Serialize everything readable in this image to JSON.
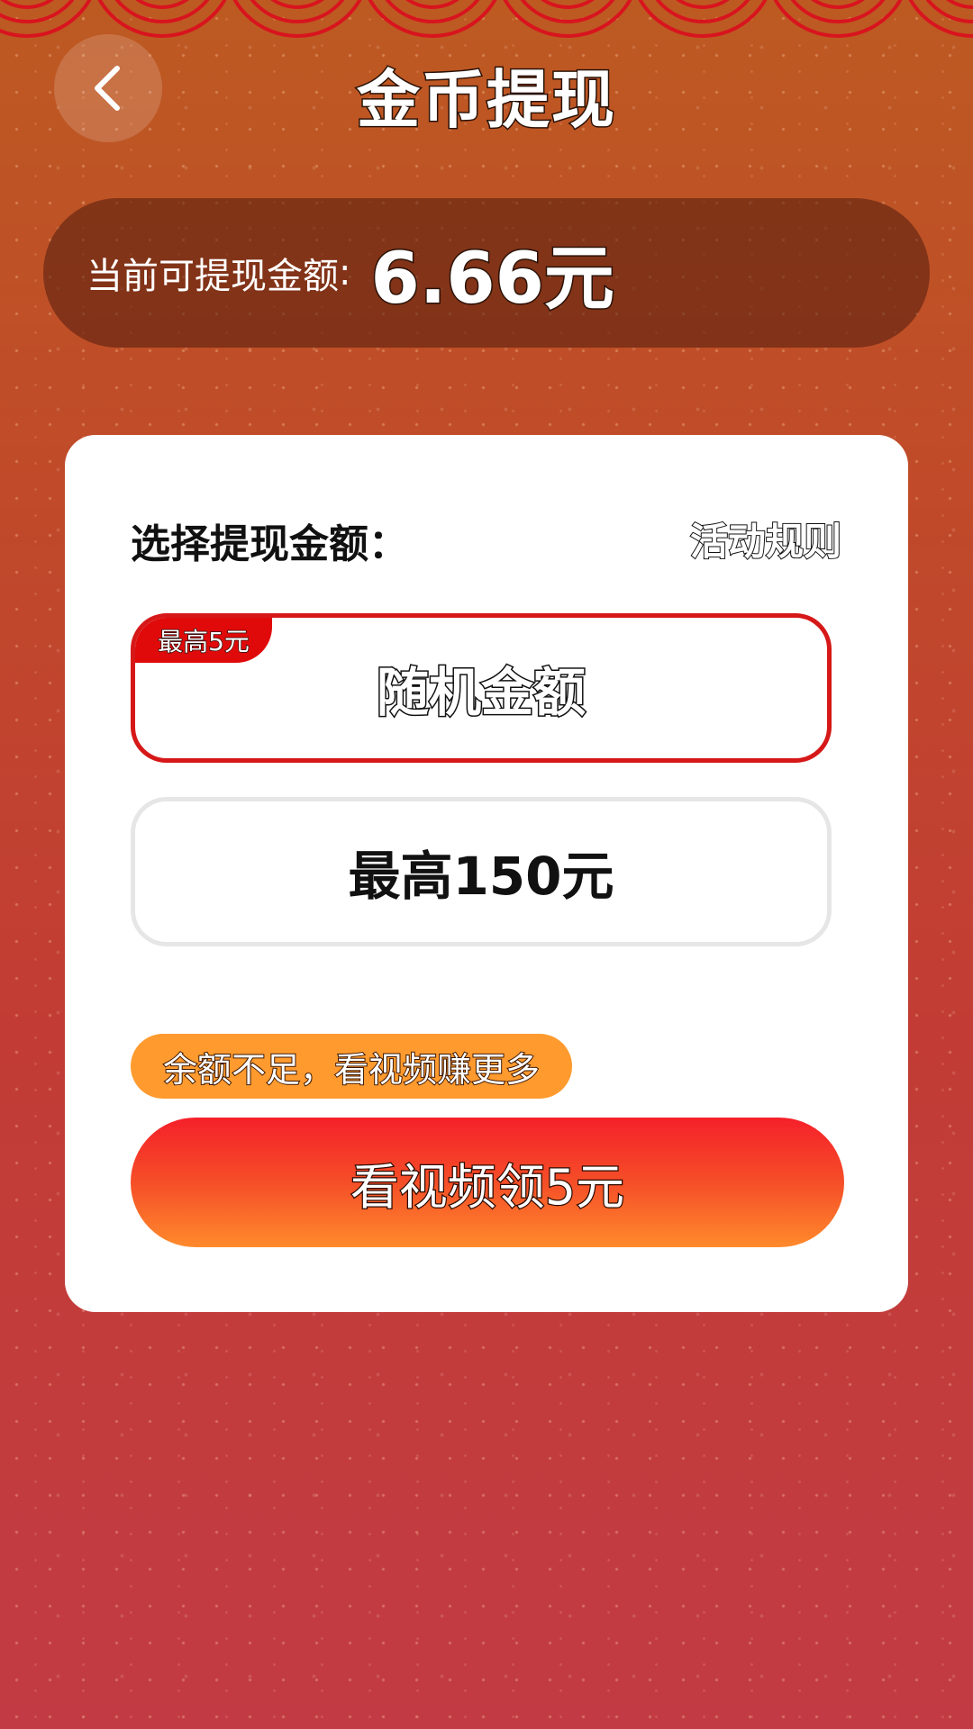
{
  "header": {
    "title": "金币提现",
    "back_icon": "chevron-left-icon"
  },
  "balance": {
    "label": "当前可提现金额",
    "colon": ":",
    "value": "6.66元"
  },
  "card": {
    "title": "选择提现金额：",
    "rules_link": "活动规则",
    "options": [
      {
        "label": "随机金额",
        "badge": "最高5元",
        "selected": true
      },
      {
        "label": "最高150元",
        "selected": false
      }
    ],
    "hint": "余额不足，看视频赚更多",
    "cta": "看视频领5元"
  },
  "colors": {
    "accent_red": "#d61818",
    "badge_red": "#e00a0a",
    "hint_orange": "#ff9a2e",
    "cta_gradient_top": "#f5202a",
    "cta_gradient_bottom": "#ff8a2c"
  }
}
